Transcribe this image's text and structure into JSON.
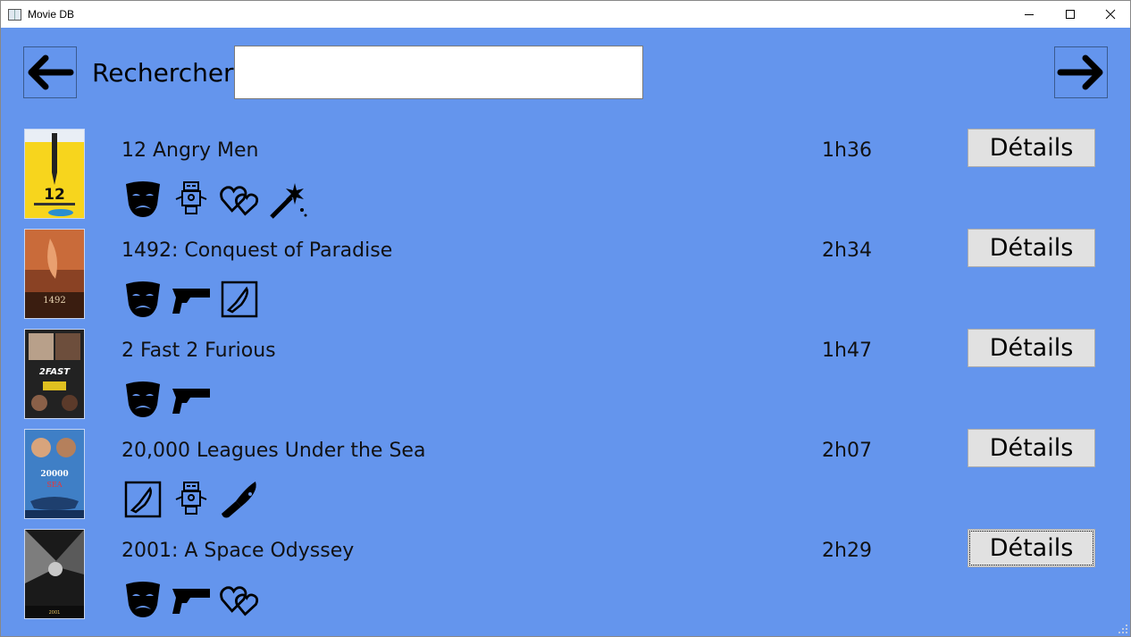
{
  "window": {
    "title": "Movie DB"
  },
  "search": {
    "label": "Rechercher:",
    "value": ""
  },
  "nav": {
    "prev": "arrow-left-icon",
    "next": "arrow-right-icon"
  },
  "colors": {
    "background": "#6495ed",
    "button": "#e1e1e1"
  },
  "movies": [
    {
      "title": "12 Angry Men",
      "duration": "1h36",
      "details_label": "Détails",
      "genres": [
        "drama-icon",
        "robot-icon",
        "hearts-icon",
        "magic-wand-icon"
      ]
    },
    {
      "title": "1492: Conquest of Paradise",
      "duration": "2h34",
      "details_label": "Détails",
      "genres": [
        "drama-icon",
        "gun-icon",
        "knife-box-icon"
      ]
    },
    {
      "title": "2 Fast 2 Furious",
      "duration": "1h47",
      "details_label": "Détails",
      "genres": [
        "drama-icon",
        "gun-icon"
      ]
    },
    {
      "title": "20,000 Leagues Under the Sea",
      "duration": "2h07",
      "details_label": "Détails",
      "genres": [
        "knife-box-icon",
        "robot-icon",
        "bloody-knife-icon"
      ]
    },
    {
      "title": "2001: A Space Odyssey",
      "duration": "2h29",
      "details_label": "Détails",
      "genres": [
        "drama-icon",
        "gun-icon",
        "hearts-icon"
      ]
    }
  ]
}
